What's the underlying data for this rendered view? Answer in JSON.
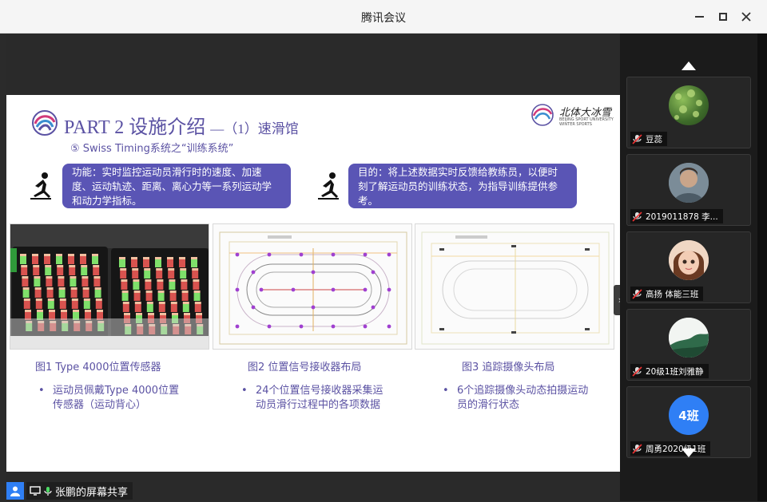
{
  "window": {
    "title": "腾讯会议",
    "minimize_label": "minimize",
    "maximize_label": "maximize",
    "close_label": "close"
  },
  "slide": {
    "title_main": "PART 2 设施介绍",
    "title_sub": "—（1）速滑馆",
    "subtitle": "⑤ Swiss Timing系统之“训练系统”",
    "brand_name": "北体大冰雪",
    "brand_small_1": "BEIJING SPORT UNIVERSITY",
    "brand_small_2": "WINTER SPORTS",
    "function_text": "功能：实时监控运动员滑行时的速度、加速度、运动轨迹、距离、离心力等一系列运动学和动力学指标。",
    "purpose_text": "目的：将上述数据实时反馈给教练员，以便时刻了解运动员的训练状态，为指导训练提供参考。",
    "fig1_caption": "图1 Type 4000位置传感器",
    "fig2_caption": "图2 位置信号接收器布局",
    "fig3_caption": "图3 追踪摄像头布局",
    "bullet1": "运动员佩戴Type 4000位置传感器（运动背心）",
    "bullet2": "24个位置信号接收器采集运动员滑行过程中的各项数据",
    "bullet3": "6个追踪摄像头动态拍摄运动员的滑行状态",
    "bullet_symbol": "•"
  },
  "participants": [
    {
      "name": "豆蕊",
      "avatar": "leaf-photo-avatar"
    },
    {
      "name": "2019011878 李...",
      "avatar": "portrait-photo-avatar"
    },
    {
      "name": "高扬 体能三班",
      "avatar": "cartoon-girl-avatar"
    },
    {
      "name": "20级1班刘雅静",
      "avatar": "landscape-photo-avatar"
    },
    {
      "name": "周勇2020级1班",
      "avatar": "text-avatar",
      "avatar_text": "4班"
    }
  ],
  "share_label": "张鹏的屏幕共享",
  "colors": {
    "accent": "#5b52a3",
    "bubble": "#5a55b5",
    "share_icon": "#2f7ff5",
    "avatar_blue": "#2f7ff5"
  }
}
